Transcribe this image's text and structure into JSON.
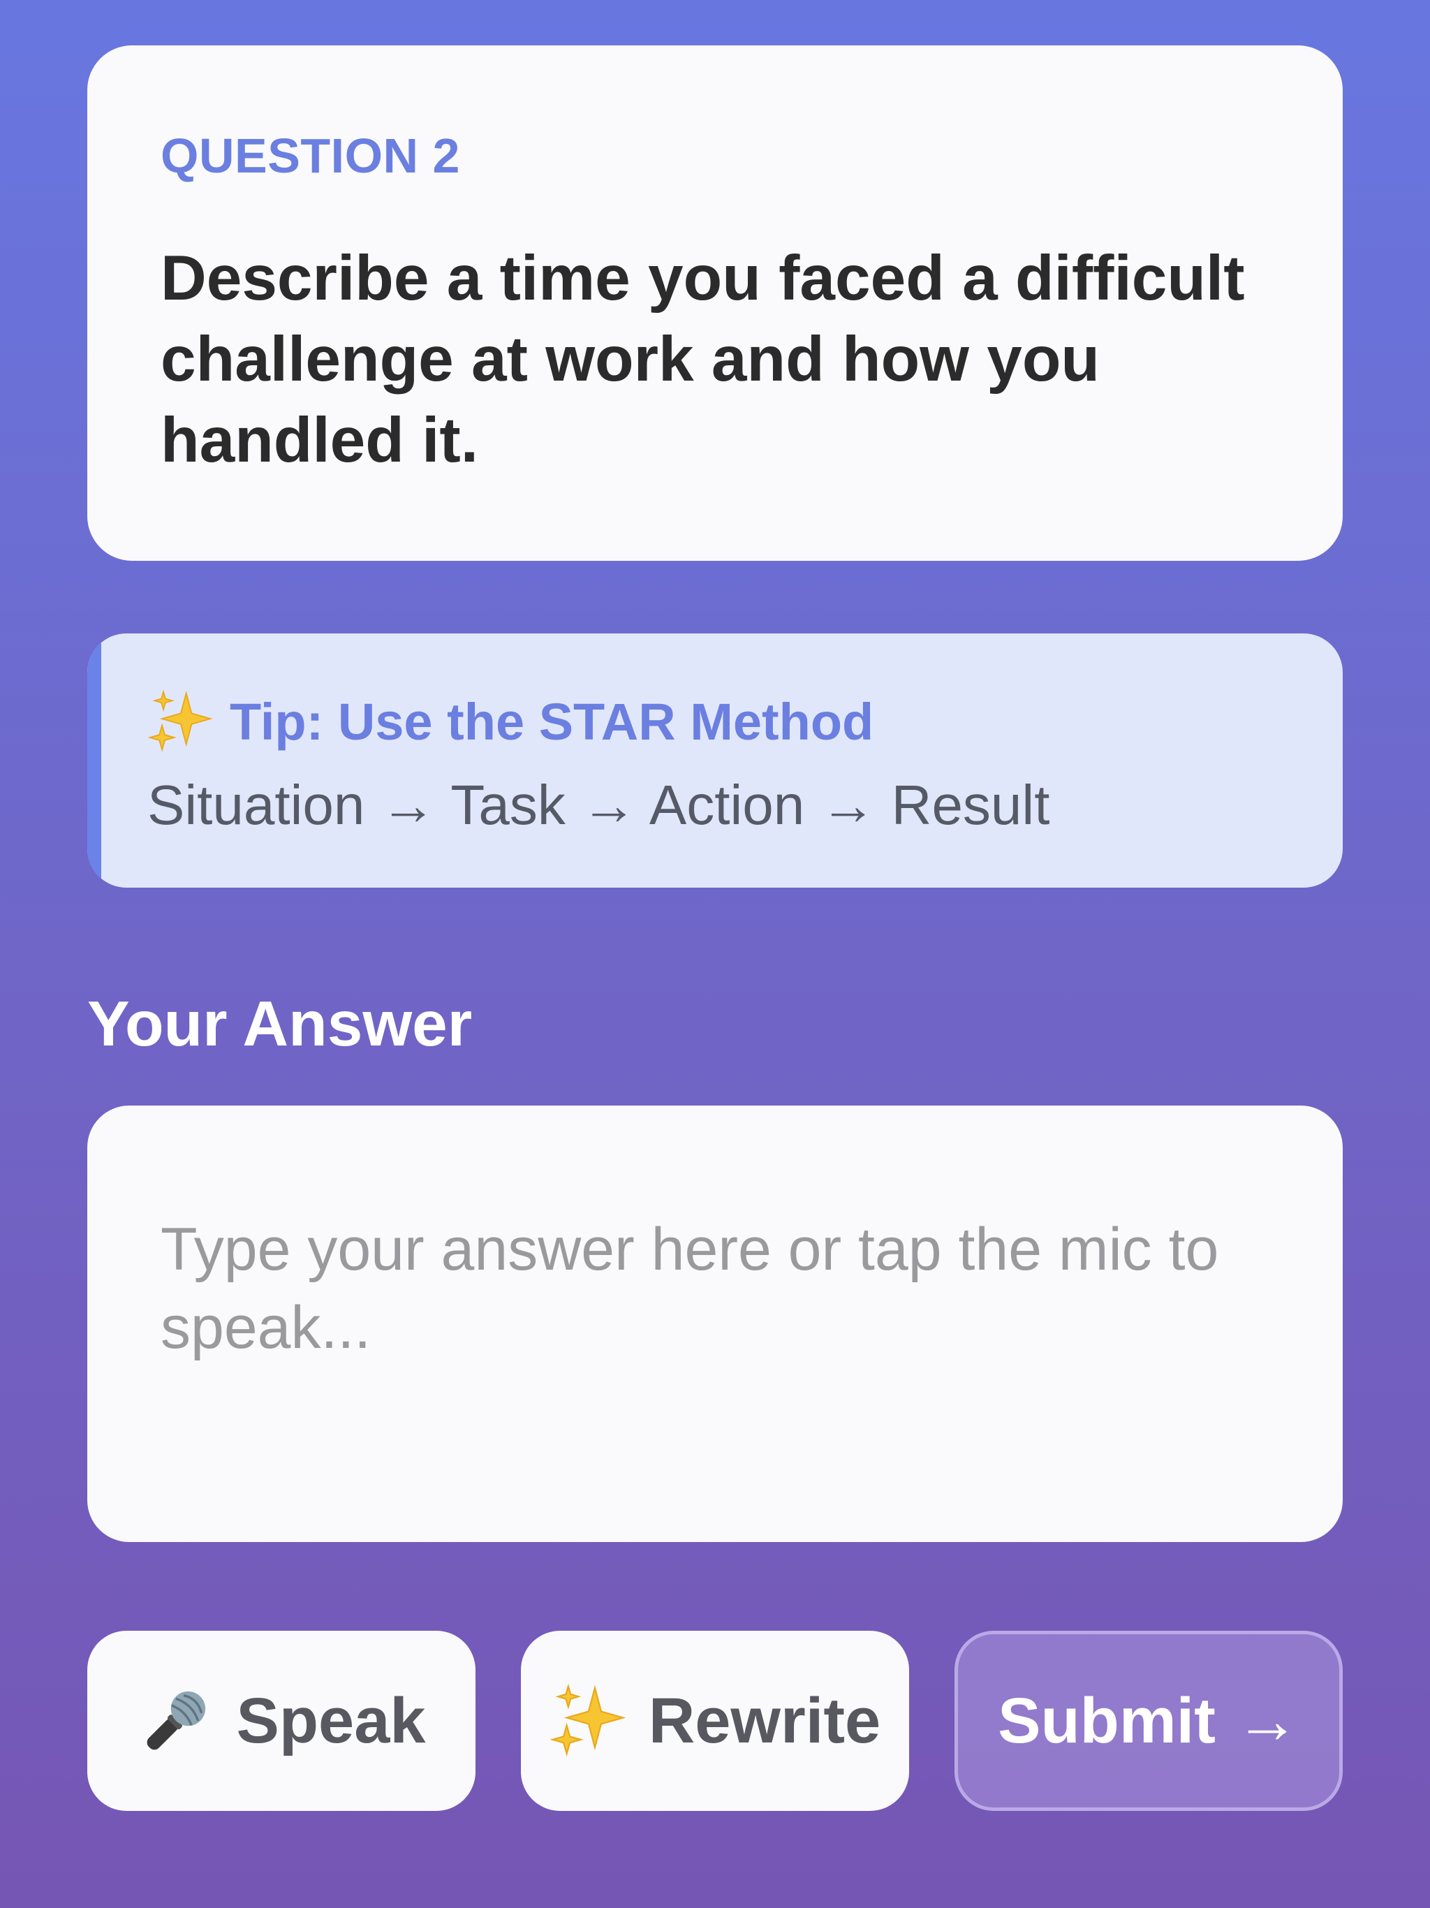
{
  "question": {
    "number_label": "QUESTION 2",
    "text": "Describe a time you faced a difficult challenge at work and how you handled it."
  },
  "tip": {
    "icon": "sparkles-icon",
    "title": "Tip: Use the STAR Method",
    "steps": "Situation → Task → Action → Result",
    "accent_color": "#6b82e8"
  },
  "answer": {
    "label": "Your Answer",
    "value": "",
    "placeholder": "Type your answer here or tap the mic to speak..."
  },
  "actions": {
    "speak": {
      "icon": "microphone-icon",
      "label": "Speak"
    },
    "rewrite": {
      "icon": "sparkles-icon",
      "label": "Rewrite"
    },
    "submit": {
      "label": "Submit",
      "arrow": "→"
    }
  },
  "colors": {
    "brand_blue": "#6b7fe0",
    "gradient_top": "#6877e0",
    "gradient_bottom": "#7656b4"
  }
}
